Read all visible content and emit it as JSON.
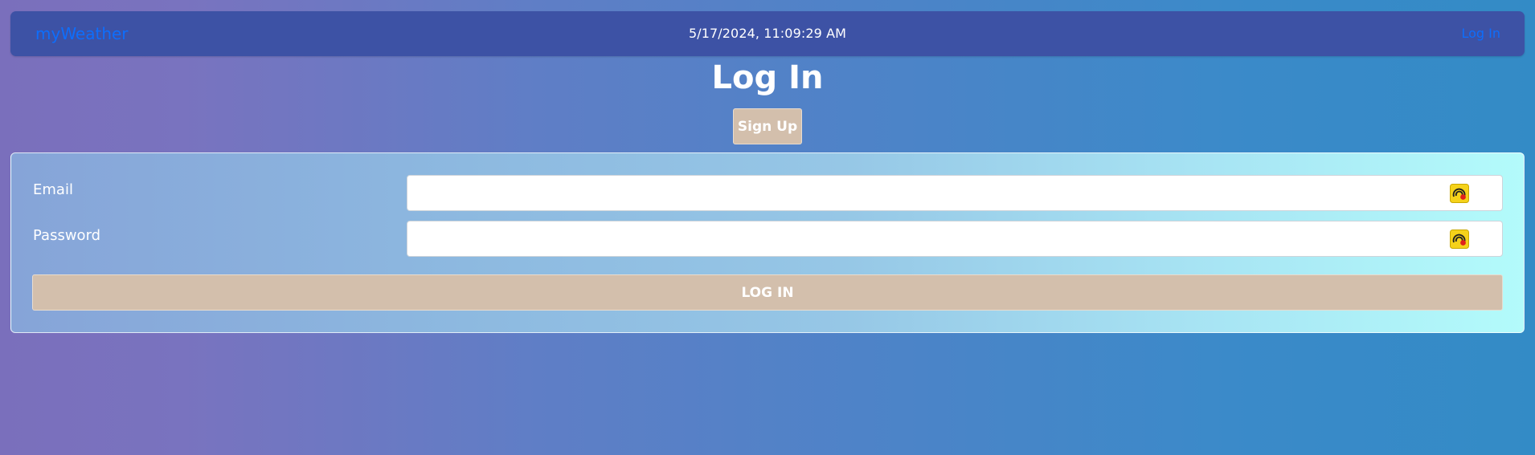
{
  "navbar": {
    "brand": "myWeather",
    "datetime": "5/17/2024, 11:09:29 AM",
    "login_link": "Log In"
  },
  "page": {
    "title": "Log In",
    "signup_label": "Sign Up"
  },
  "form": {
    "email_label": "Email",
    "email_value": "",
    "password_label": "Password",
    "password_value": "",
    "submit_label": "LOG IN"
  },
  "icons": {
    "password_manager": "password-manager-icon"
  },
  "colors": {
    "brand_link": "#0d6efd",
    "navbar_bg": "#3d52a5",
    "button_bg": "#d3bfac",
    "icon_yellow": "#f5d21a",
    "icon_red": "#e0201b"
  }
}
